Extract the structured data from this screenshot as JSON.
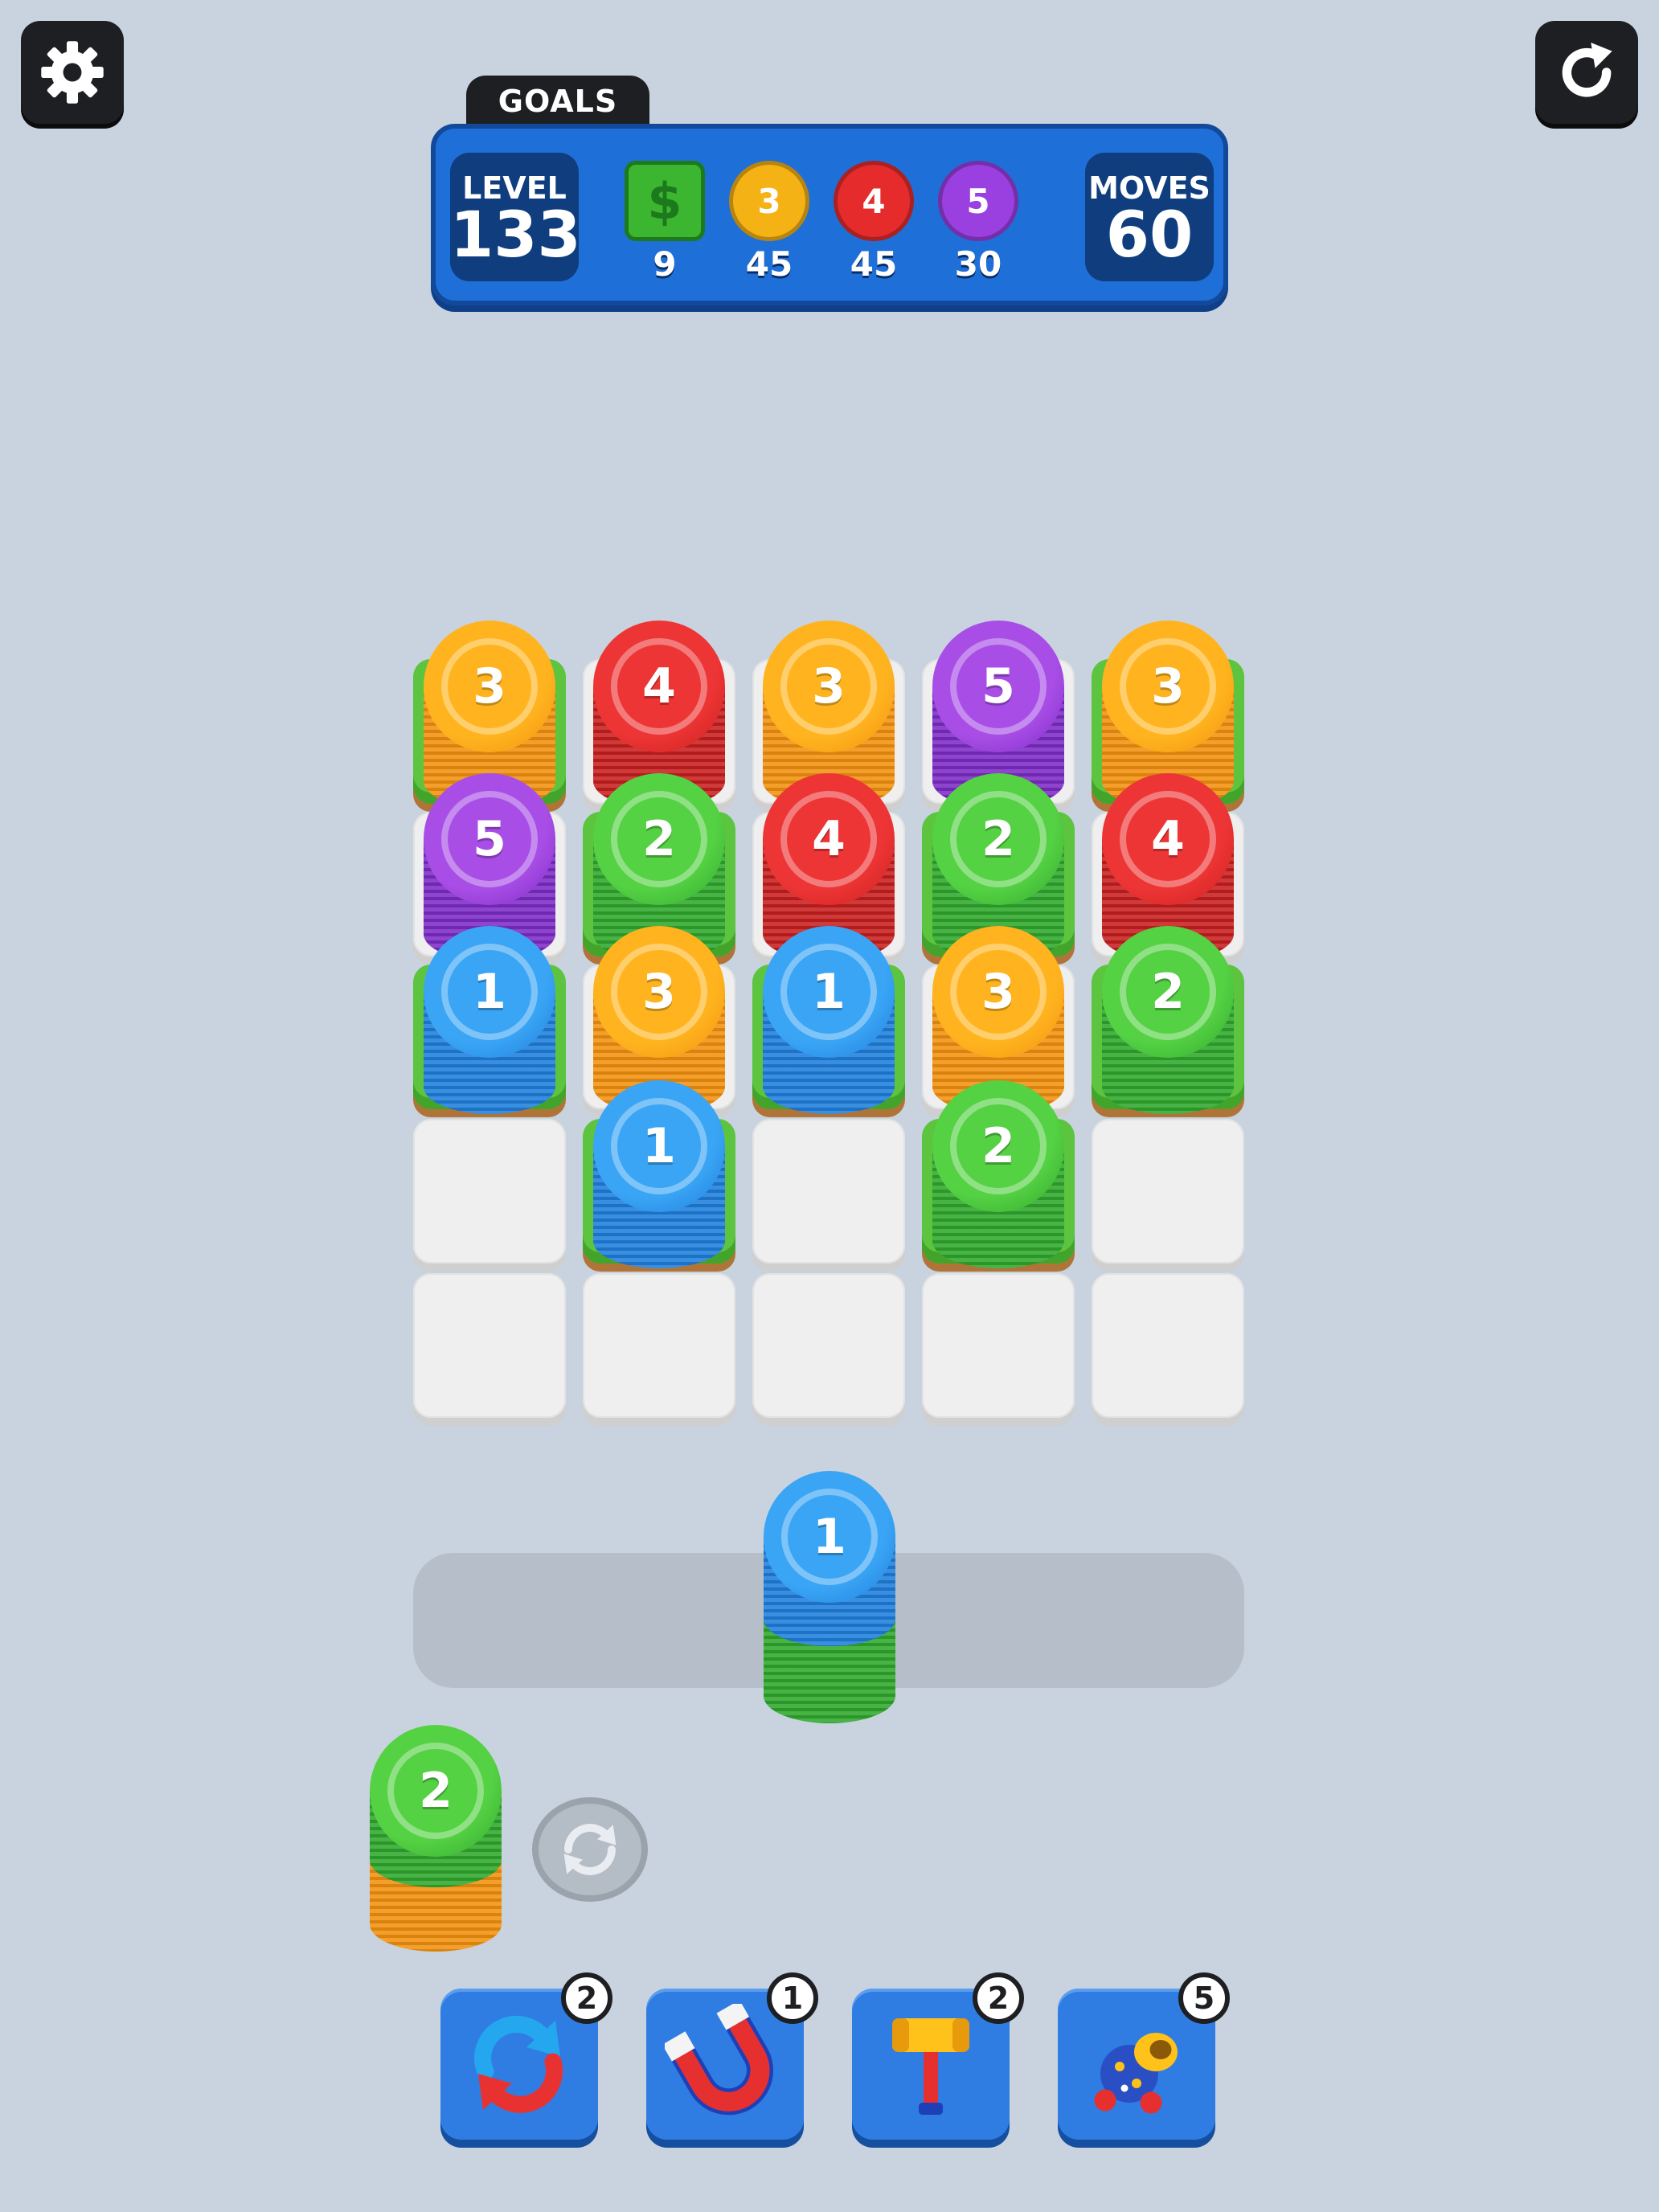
{
  "header": {
    "goals_label": "GOALS",
    "level_label": "LEVEL",
    "level_value": "133",
    "moves_label": "MOVES",
    "moves_value": "60"
  },
  "goals": [
    {
      "icon": "money-icon",
      "symbol": "$",
      "count": "9",
      "color": "#3cb531"
    },
    {
      "icon": "coin-3-icon",
      "symbol": "3",
      "count": "45",
      "color": "#f4b215"
    },
    {
      "icon": "coin-4-icon",
      "symbol": "4",
      "count": "45",
      "color": "#e52b2b"
    },
    {
      "icon": "coin-5-icon",
      "symbol": "5",
      "count": "30",
      "color": "#9a3fe0"
    }
  ],
  "board": {
    "rows": 5,
    "cols": 5,
    "tiles": [
      [
        "grass",
        "empty",
        "empty",
        "empty",
        "grass"
      ],
      [
        "empty",
        "grass",
        "empty",
        "grass",
        "empty"
      ],
      [
        "grass",
        "empty",
        "grass",
        "empty",
        "grass"
      ],
      [
        "empty",
        "grass",
        "empty",
        "grass",
        "empty"
      ],
      [
        "empty",
        "empty",
        "empty",
        "empty",
        "empty"
      ]
    ],
    "stacks": [
      [
        "3",
        "4",
        "3",
        "5",
        "3"
      ],
      [
        "5",
        "2",
        "4",
        "2",
        "4"
      ],
      [
        "1",
        "3",
        "1",
        "3",
        "2"
      ],
      [
        "",
        "1",
        "",
        "2",
        ""
      ],
      [
        "",
        "",
        "",
        "",
        ""
      ]
    ]
  },
  "colors": {
    "1": {
      "top": "#3aa5f5",
      "side": "#1f7fdc"
    },
    "2": {
      "top": "#55d144",
      "side": "#2fa82c"
    },
    "3": {
      "top": "#ffb41f",
      "side": "#f2920f"
    },
    "4": {
      "top": "#ee3535",
      "side": "#c81f1f"
    },
    "5": {
      "top": "#a84ee6",
      "side": "#7d2bc6"
    }
  },
  "tray_stack": {
    "label": "1",
    "layers": [
      "2",
      "1"
    ]
  },
  "next_stack": {
    "label": "2",
    "layers": [
      "3",
      "2"
    ]
  },
  "boosters": [
    {
      "name": "swap-booster",
      "icon": "swap-arrows-icon",
      "count": "2"
    },
    {
      "name": "magnet-booster",
      "icon": "magnet-icon",
      "count": "1"
    },
    {
      "name": "hammer-booster",
      "icon": "hammer-icon",
      "count": "2"
    },
    {
      "name": "cannon-booster",
      "icon": "cannon-icon",
      "count": "5"
    }
  ]
}
